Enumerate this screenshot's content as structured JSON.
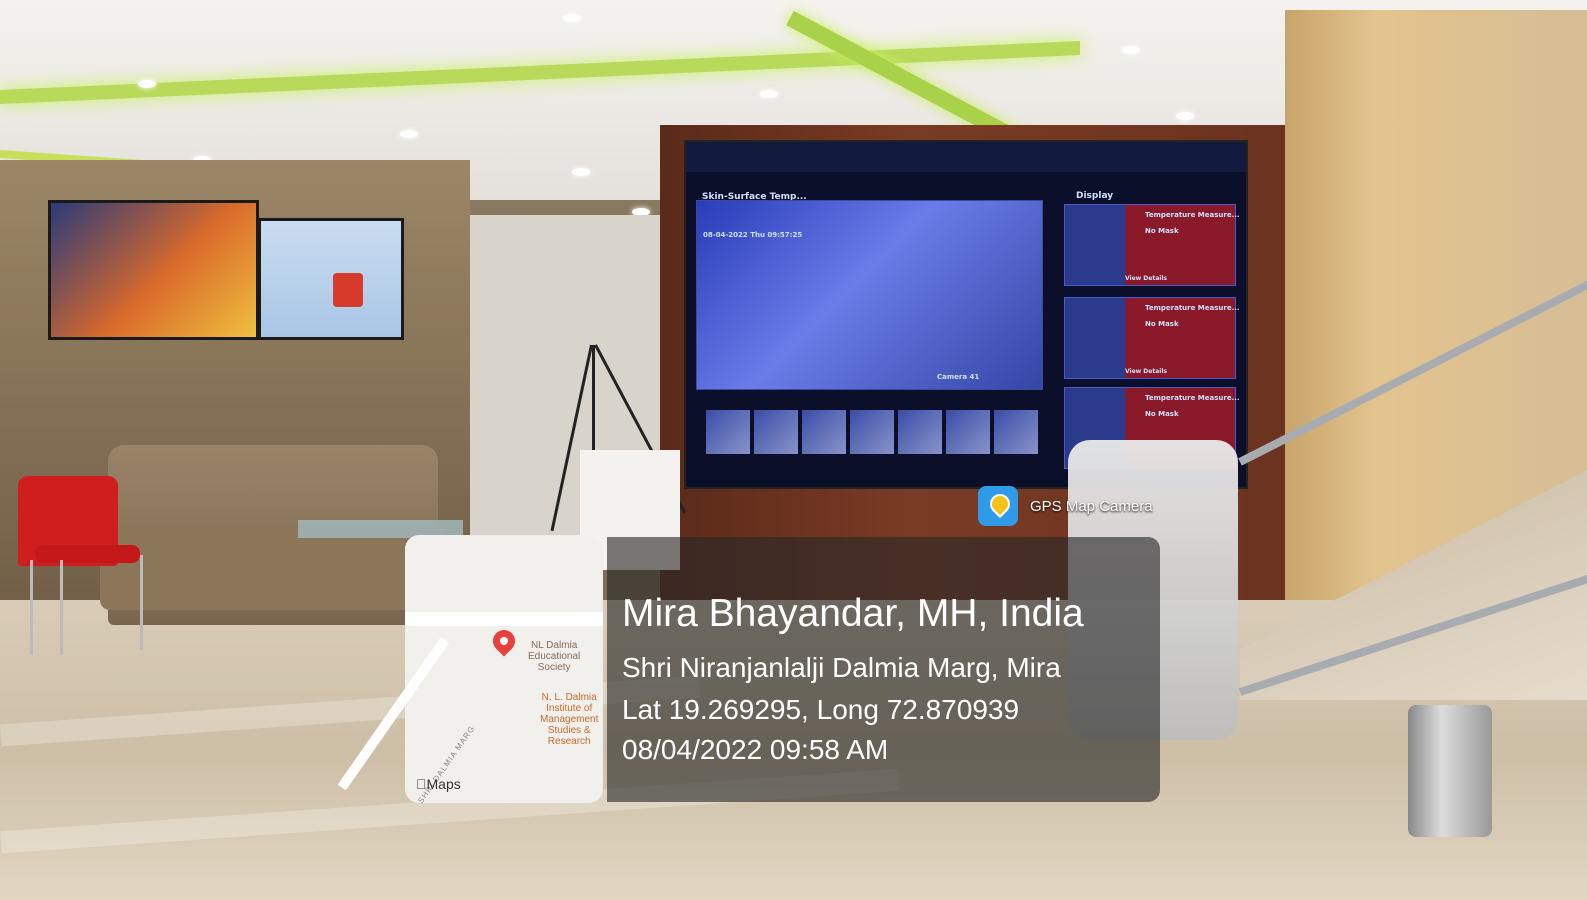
{
  "overlay": {
    "app_label": "GPS Map Camera",
    "location_title": "Mira Bhayandar, MH, India",
    "address": "Shri Niranjanlalji Dalmia Marg, Mira",
    "coordinates": "Lat 19.269295, Long 72.870939",
    "datetime": "08/04/2022 09:58 AM"
  },
  "map": {
    "label_society": "NL Dalmia\nEducational\nSociety",
    "label_institute": "N. L. Dalmia\nInstitute of\nManagement\nStudies &\nResearch",
    "road_label": "SHRI DALMIA MARG",
    "brand": "Maps"
  },
  "video_wall": {
    "title": "Skin-Surface Temp...",
    "display_label": "Display",
    "timestamp": "08-04-2022 Thu 09:57:25",
    "camera_label": "Camera 41",
    "card_title": "Temperature Measure...",
    "card_status": "No Mask",
    "view_details": "View Details"
  }
}
